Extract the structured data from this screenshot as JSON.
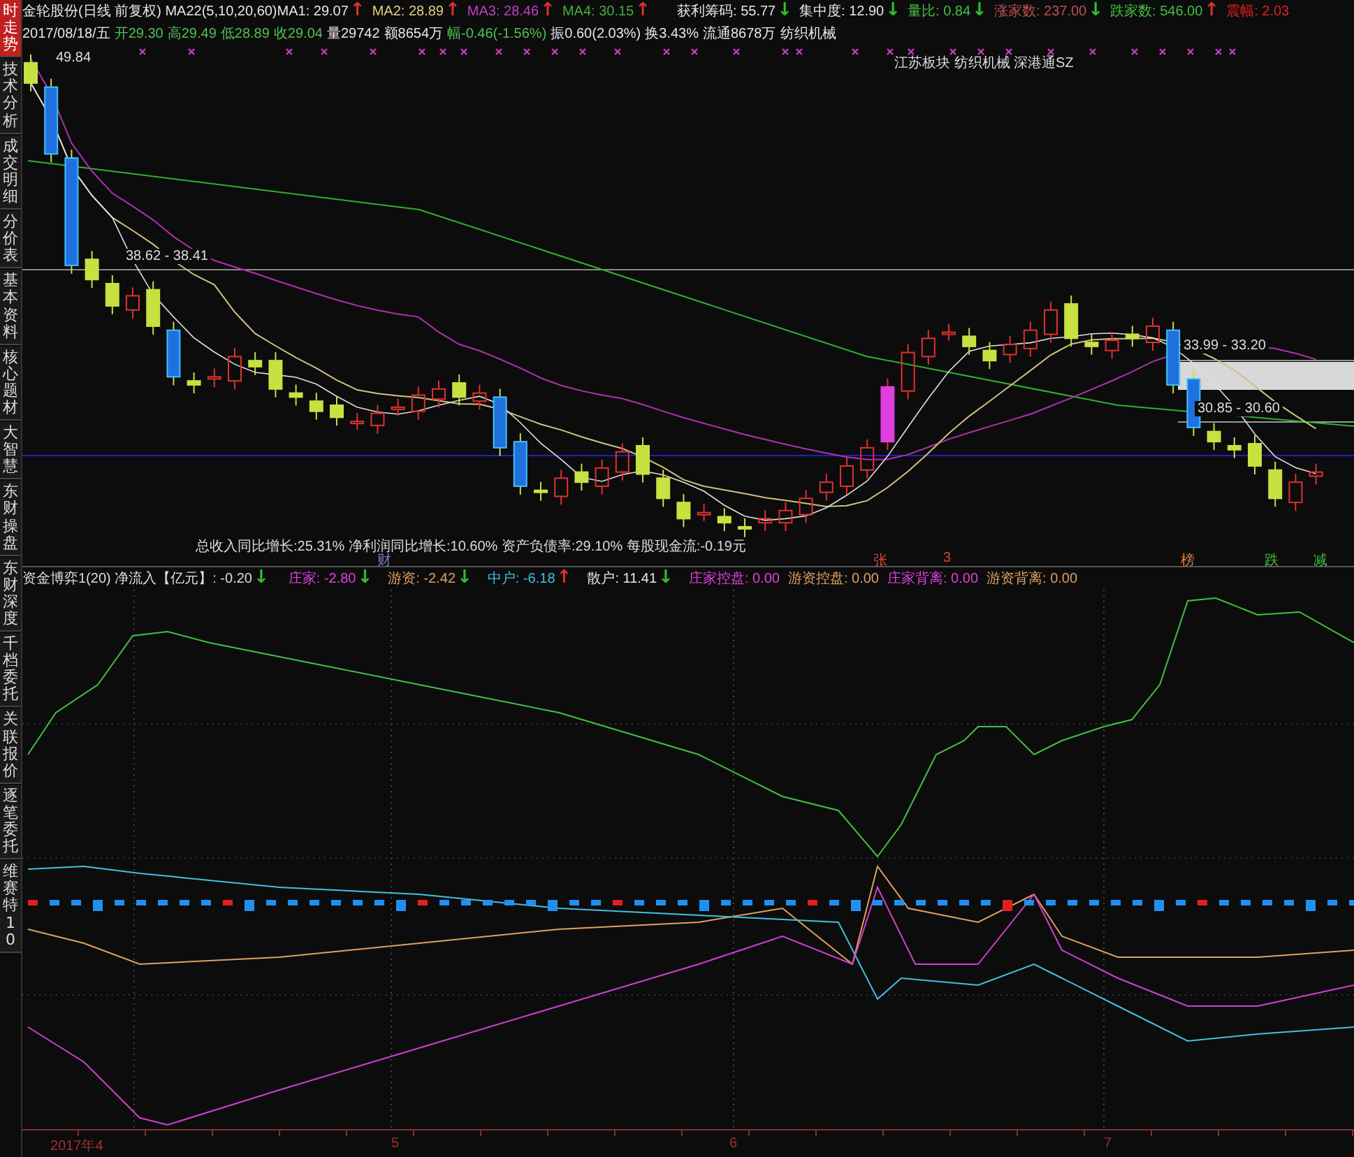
{
  "sidebar": {
    "tabs": [
      {
        "label": "时走势",
        "selected": true
      },
      {
        "label": "技术分析",
        "selected": false
      },
      {
        "label": "成交明细",
        "selected": false
      },
      {
        "label": "分价表",
        "selected": false
      },
      {
        "label": "基本资料",
        "selected": false
      },
      {
        "label": "核心题材",
        "selected": false
      },
      {
        "label": "大智慧",
        "selected": false
      },
      {
        "label": "东财操盘",
        "selected": false
      },
      {
        "label": "东财深度",
        "selected": false
      },
      {
        "label": "千档委托",
        "selected": false
      },
      {
        "label": "关联报价",
        "selected": false
      },
      {
        "label": "逐笔委托",
        "selected": false
      },
      {
        "label": "维赛特10",
        "selected": false
      }
    ]
  },
  "header": {
    "line_1": [
      {
        "text": "金轮股份(日线 前复权) MA22(5,10,20,60)",
        "color": "#e6e6e6"
      },
      {
        "text": "MA1: 29.07",
        "color": "#e6e6e6",
        "arrow": {
          "text": "↑",
          "color": "#e03030"
        }
      },
      {
        "text": "MA2: 28.89",
        "color": "#e0d080",
        "arrow": {
          "text": "↑",
          "color": "#e03030"
        }
      },
      {
        "text": "MA3: 28.46",
        "color": "#c040c0",
        "arrow": {
          "text": "↑",
          "color": "#e03030"
        }
      },
      {
        "text": "MA4: 30.15",
        "color": "#40b040",
        "arrow": {
          "text": "↑",
          "color": "#e03030"
        }
      },
      {
        "text": "获利筹码: 55.77",
        "color": "#e6e6e6",
        "arrow": {
          "text": "↓",
          "color": "#30c030"
        }
      },
      {
        "text": "集中度: 12.90",
        "color": "#e6e6e6",
        "arrow": {
          "text": "↓",
          "color": "#30c030"
        }
      },
      {
        "text": "量比: 0.84",
        "color": "#40c040",
        "arrow": {
          "text": "↓",
          "color": "#30c030"
        }
      },
      {
        "text": "涨家数: 237.00",
        "color": "#c05050",
        "arrow": {
          "text": "↓",
          "color": "#30c030"
        }
      },
      {
        "text": "跌家数: 546.00",
        "color": "#40c040",
        "arrow": {
          "text": "↑",
          "color": "#e03030"
        }
      },
      {
        "text": "震幅: 2.03",
        "color": "#e02020"
      }
    ],
    "line_2": [
      {
        "text": "2017/08/18/五",
        "color": "#e6e6e6"
      },
      {
        "text": "开29.30",
        "color": "#50c050"
      },
      {
        "text": "高29.49",
        "color": "#50c050"
      },
      {
        "text": "低28.89",
        "color": "#50c050"
      },
      {
        "text": "收29.04",
        "color": "#50c050"
      },
      {
        "text": "量29742",
        "color": "#e6e6e6"
      },
      {
        "text": "额8654万",
        "color": "#e6e6e6"
      },
      {
        "text": "幅-0.46(-1.56%)",
        "color": "#50c050"
      },
      {
        "text": "振0.60(2.03%)",
        "color": "#e6e6e6"
      },
      {
        "text": "换3.43%",
        "color": "#e6e6e6"
      },
      {
        "text": "流通8678万",
        "color": "#e6e6e6"
      },
      {
        "text": "纺织机械",
        "color": "#e6e6e6"
      }
    ]
  },
  "price_chart": {
    "high_label": "49.84",
    "sector_text": "江苏板块 纺织机械 深港通SZ",
    "level_labels": [
      {
        "text": "38.62 - 38.41"
      },
      {
        "text": "33.99 - 33.20"
      },
      {
        "text": "30.85 - 30.60"
      }
    ],
    "finance_text": "总收入同比增长:25.31%  净利润同比增长:10.60%  资产负债率:29.10%  每股现金流:-0.19元",
    "event_marks": [
      {
        "text": "财",
        "color": "#8080c0"
      },
      {
        "text": "张",
        "color": "#e04040"
      },
      {
        "text": "3",
        "color": "#e04040"
      },
      {
        "text": "榜",
        "color": "#e08040"
      },
      {
        "text": "跌",
        "color": "#40c040"
      },
      {
        "text": "减",
        "color": "#40c040"
      }
    ]
  },
  "indicator": {
    "title": "资金博弈1(20) 净流入【亿元】: -0.20",
    "title_arrow": {
      "text": "↓",
      "color": "#30c030"
    },
    "items": [
      {
        "text": "庄家: -2.80",
        "color": "#e040e0",
        "arrow": {
          "text": "↓",
          "color": "#30c030"
        }
      },
      {
        "text": "游资: -2.42",
        "color": "#e0a060",
        "arrow": {
          "text": "↓",
          "color": "#30c030"
        }
      },
      {
        "text": "中户: -6.18",
        "color": "#40c0e0",
        "arrow": {
          "text": "↑",
          "color": "#e03030"
        }
      },
      {
        "text": "散户: 11.41",
        "color": "#e6e6e6",
        "arrow": {
          "text": "↓",
          "color": "#30c030"
        }
      },
      {
        "text": "庄家控盘: 0.00",
        "color": "#e040e0"
      },
      {
        "text": "游资控盘: 0.00",
        "color": "#e0a060"
      },
      {
        "text": "庄家背离: 0.00",
        "color": "#e040e0"
      },
      {
        "text": "游资背离: 0.00",
        "color": "#e0a060"
      }
    ]
  },
  "time_axis": [
    {
      "label": "2017年4"
    },
    {
      "label": "5"
    },
    {
      "label": "6"
    },
    {
      "label": "7"
    }
  ]
}
